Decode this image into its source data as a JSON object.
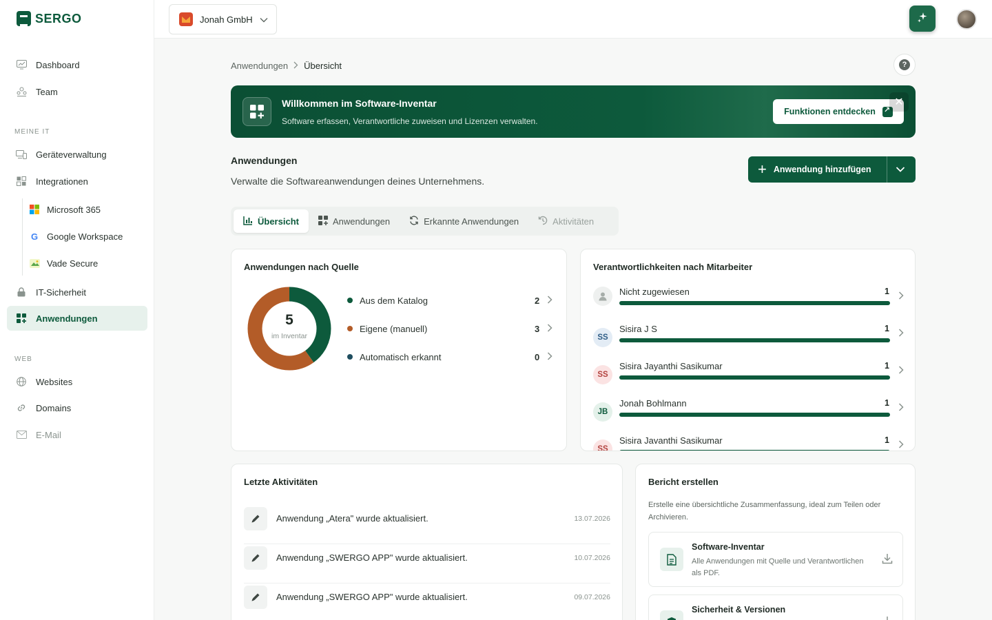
{
  "app": {
    "logo_text": "SERGO"
  },
  "sidebar": {
    "items": [
      {
        "label": "Dashboard",
        "icon": "monitor-chart-icon"
      },
      {
        "label": "Team",
        "icon": "team-icon"
      }
    ],
    "section_meine_it": "MEINE IT",
    "meine_it": [
      {
        "label": "Geräteverwaltung",
        "icon": "devices-icon"
      },
      {
        "label": "Integrationen",
        "icon": "puzzle-icon"
      }
    ],
    "integrations": [
      {
        "label": "Microsoft 365",
        "icon": "microsoft-icon"
      },
      {
        "label": "Google Workspace",
        "icon": "google-icon"
      },
      {
        "label": "Vade Secure",
        "icon": "vade-icon"
      }
    ],
    "security": {
      "label": "IT-Sicherheit",
      "icon": "lock-icon"
    },
    "active": {
      "label": "Anwendungen",
      "icon": "apps-grid-icon"
    },
    "section_web": "WEB",
    "web": [
      {
        "label": "Websites",
        "icon": "globe-icon"
      },
      {
        "label": "Domains",
        "icon": "link-icon"
      },
      {
        "label": "E-Mail",
        "icon": "mail-icon"
      }
    ]
  },
  "topbar": {
    "org_name": "Jonah GmbH"
  },
  "breadcrumb": {
    "parent": "Anwendungen",
    "current": "Übersicht"
  },
  "banner": {
    "title": "Willkommen im Software-Inventar",
    "subtitle": "Software erfassen, Verantwortliche zuweisen und Lizenzen verwalten.",
    "button": "Funktionen entdecken"
  },
  "header": {
    "title": "Anwendungen",
    "subtitle": "Verwalte die Softwareanwendungen deines Unternehmens.",
    "add_button": "Anwendung hinzufügen"
  },
  "tabs": [
    {
      "label": "Übersicht",
      "icon": "bar-chart-icon"
    },
    {
      "label": "Anwendungen",
      "icon": "apps-grid-icon"
    },
    {
      "label": "Erkannte Anwendungen",
      "icon": "refresh-icon"
    },
    {
      "label": "Aktivitäten",
      "icon": "history-icon"
    }
  ],
  "sources_card": {
    "title": "Anwendungen nach Quelle",
    "total": "5",
    "total_label": "im Inventar",
    "colors": {
      "catalog": "#0d5a3c",
      "manual": "#b35c28",
      "auto": "#1f4e5f"
    },
    "legend": [
      {
        "label": "Aus dem Katalog",
        "value": "2"
      },
      {
        "label": "Eigene (manuell)",
        "value": "3"
      },
      {
        "label": "Automatisch erkannt",
        "value": "0"
      }
    ]
  },
  "chart_data": {
    "type": "pie",
    "categories": [
      "Aus dem Katalog",
      "Eigene (manuell)",
      "Automatisch erkannt"
    ],
    "values": [
      2,
      3,
      0
    ]
  },
  "owners_card": {
    "title": "Verantwortlichkeiten nach Mitarbeiter",
    "rows": [
      {
        "initials": "",
        "name": "Nicht zugewiesen",
        "count": "1",
        "share": 1
      },
      {
        "initials": "SS",
        "name": "Sisira J S",
        "count": "1",
        "share": 1
      },
      {
        "initials": "SS",
        "name": "Sisira Jayanthi Sasikumar",
        "count": "1",
        "share": 1
      },
      {
        "initials": "JB",
        "name": "Jonah Bohlmann",
        "count": "1",
        "share": 1
      },
      {
        "initials": "SS",
        "name": "Sisira Javanthi Sasikumar",
        "count": "1",
        "share": 1
      }
    ]
  },
  "activities_card": {
    "title": "Letzte Aktivitäten",
    "rows": [
      {
        "text": "Anwendung „Atera\" wurde aktualisiert.",
        "date": "13.07.2026"
      },
      {
        "text": "Anwendung „SWERGO APP\" wurde aktualisiert.",
        "date": "10.07.2026"
      },
      {
        "text": "Anwendung „SWERGO APP\" wurde aktualisiert.",
        "date": "09.07.2026"
      }
    ]
  },
  "report_card": {
    "title": "Bericht erstellen",
    "description": "Erstelle eine übersichtliche Zusammenfassung, ideal zum Teilen oder Archivieren.",
    "items": [
      {
        "title": "Software-Inventar",
        "subtitle": "Alle Anwendungen mit Quelle und Verantwortlichen als PDF."
      },
      {
        "title": "Sicherheit & Versionen",
        "subtitle": ""
      }
    ]
  }
}
